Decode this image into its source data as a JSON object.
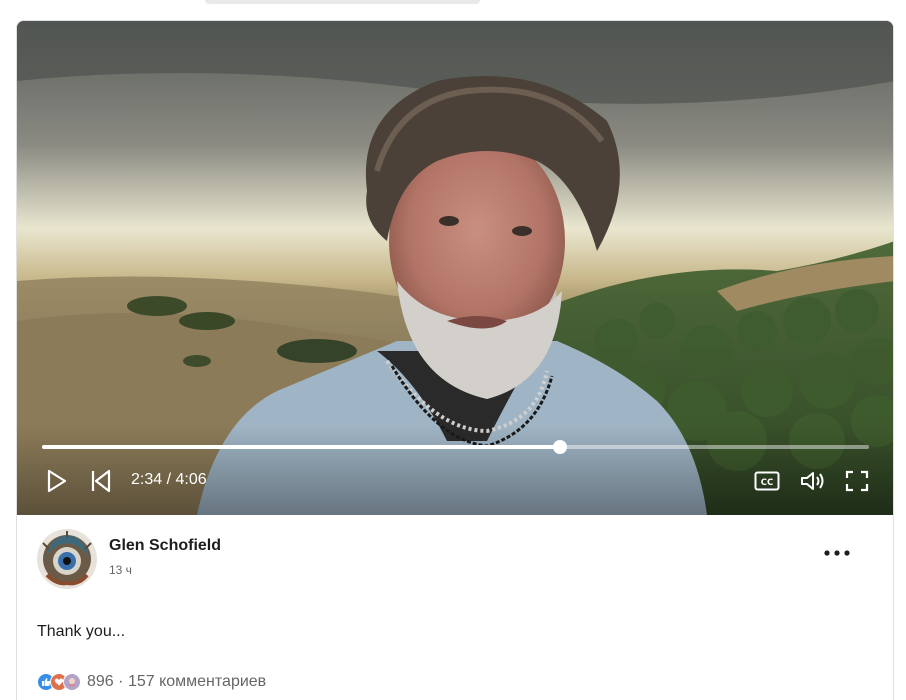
{
  "video": {
    "current_time": "2:34",
    "duration": "4:06",
    "time_display": "2:34 / 4:06",
    "progress_fraction": 0.626
  },
  "post": {
    "author": "Glen Schofield",
    "time_ago": "13 ч",
    "text": "Thank you...",
    "reaction_count": "896",
    "separator": "·",
    "comments": "157 комментариев"
  },
  "icons": {
    "play": "play-icon",
    "previous": "skip-back-icon",
    "captions": "closed-captions-icon",
    "volume": "volume-icon",
    "fullscreen": "fullscreen-icon",
    "more": "more-options-icon"
  },
  "colors": {
    "like": "#378fe9",
    "love": "#df704d",
    "text": "#1d1d1d",
    "muted": "#666666"
  }
}
